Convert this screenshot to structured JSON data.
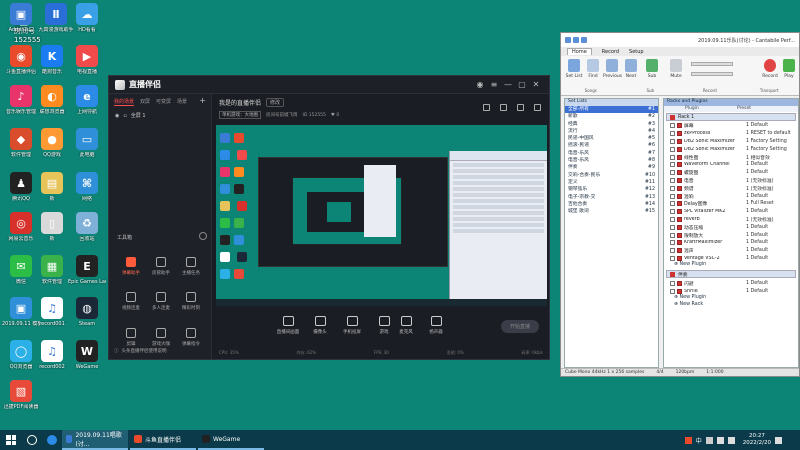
{
  "watermark": {
    "line1": "S鱼",
    "line2": "房间号",
    "line3": "152555"
  },
  "desktop_icons": [
    {
      "id": "admin",
      "label": "Adminis...",
      "color": "#3a7bd5",
      "glyph": "▣"
    },
    {
      "id": "jiuqi",
      "label": "九霄漫游戏助手",
      "color": "#2a6fd8",
      "glyph": "Ⅱ"
    },
    {
      "id": "hdstream",
      "label": "HD看看",
      "color": "#3aa0e6",
      "glyph": "☁"
    },
    {
      "id": "douyu",
      "label": "斗鱼直播伴侣",
      "color": "#e84a2b",
      "glyph": "◉"
    },
    {
      "id": "kugou",
      "label": "酷狗音乐",
      "color": "#1a7cf0",
      "glyph": "K"
    },
    {
      "id": "tv",
      "label": "电视直播",
      "color": "#f04a4a",
      "glyph": "▶"
    },
    {
      "id": "music",
      "label": "音乐娱乐管理",
      "color": "#e8336b",
      "glyph": "♪"
    },
    {
      "id": "lianxiang",
      "label": "联想浏览器",
      "color": "#ff8a1f",
      "glyph": "◐"
    },
    {
      "id": "ie",
      "label": "上网导航",
      "color": "#2b8be6",
      "glyph": "e"
    },
    {
      "id": "store",
      "label": "软件管理",
      "color": "#d94c2c",
      "glyph": "◆"
    },
    {
      "id": "qqgame",
      "label": "QQ游戏",
      "color": "#ff9933",
      "glyph": "●"
    },
    {
      "id": "computer",
      "label": "此电脑",
      "color": "#2f8fd8",
      "glyph": "▭"
    },
    {
      "id": "qq",
      "label": "腾讯QQ",
      "color": "#222222",
      "glyph": "♟"
    },
    {
      "id": "folder1",
      "label": "新",
      "color": "#e6c45a",
      "glyph": "▤"
    },
    {
      "id": "network",
      "label": "网络",
      "color": "#2f8fd8",
      "glyph": "⌘"
    },
    {
      "id": "netease",
      "label": "网易云音乐",
      "color": "#d8312b",
      "glyph": "◎"
    },
    {
      "id": "file1",
      "label": "新",
      "color": "#d9d9d9",
      "glyph": "▯"
    },
    {
      "id": "recycle",
      "label": "回收站",
      "color": "#7fb0d8",
      "glyph": "♻"
    },
    {
      "id": "wechat",
      "label": "微信",
      "color": "#2bbd45",
      "glyph": "✉"
    },
    {
      "id": "store2",
      "label": "软件管理",
      "color": "#3ab24a",
      "glyph": "▦"
    },
    {
      "id": "epic",
      "label": "Epic Games Launcher",
      "color": "#222222",
      "glyph": "E"
    },
    {
      "id": "sheet",
      "label": "2019.09.11 模板",
      "color": "#2f8fd8",
      "glyph": "▣"
    },
    {
      "id": "mp3a",
      "label": "record001",
      "color": "#ffffff",
      "glyph": "♫"
    },
    {
      "id": "steam",
      "label": "Steam",
      "color": "#1b2838",
      "glyph": "◍"
    },
    {
      "id": "qqbrowser",
      "label": "QQ浏览器",
      "color": "#2bb0e8",
      "glyph": "◯"
    },
    {
      "id": "mp3b",
      "label": "record002",
      "color": "#ffffff",
      "glyph": "♫"
    },
    {
      "id": "wegame",
      "label": "WeGame",
      "color": "#222222",
      "glyph": "W"
    },
    {
      "id": "pdf",
      "label": "迅捷PDF阅读器",
      "color": "#e84a3a",
      "glyph": "▧"
    }
  ],
  "app": {
    "name": "直播伴侣",
    "tabs": [
      "我的场景",
      "双屏",
      "可变屏",
      "场景"
    ],
    "scene": "全屏 1",
    "tools_label": "工具箱",
    "tools": [
      "弹幕助手",
      "房管助手",
      "主播任务",
      "视频连麦",
      "多人连麦",
      "精彩时刻",
      "剪辑",
      "游戏大咖",
      "弹幕指令"
    ],
    "tip": "头条直播伴侣使用说明",
    "room_title": "我是的直播伴侣",
    "edit_label": "修改",
    "room_category": "单机游戏：大地图",
    "room_link": "房间号前缀飞周",
    "room_id": "152555",
    "room_followers": "0",
    "controls": [
      "直播间画面",
      "摄像头",
      "手机投屏",
      "游戏",
      "麦克风",
      "扬声器"
    ],
    "start_label": "开始直播",
    "status": [
      "CPU: 35%",
      "内存: 62%",
      "FPS: 30",
      "丢帧: 0%",
      "码率: 0kb/s"
    ]
  },
  "cantabile": {
    "title": "2019.09.11乐队(讨论) - Cantabile Perf...",
    "menus": [
      "Home",
      "Record",
      "Setup"
    ],
    "ribbon": [
      "Set List",
      "Find",
      "Previous",
      "Next",
      "Sub",
      "Mute",
      "Record",
      "Play"
    ],
    "ribbon_groups": [
      "Songs",
      "Sub",
      "Record",
      "Transport"
    ],
    "setlist_header": "Set Lists",
    "setlist": [
      {
        "name": "全部-所有",
        "key": "#1"
      },
      {
        "name": "新歌",
        "key": "#2"
      },
      {
        "name": "经典",
        "key": "#3"
      },
      {
        "name": "流行",
        "key": "#4"
      },
      {
        "name": "民谣-中国风",
        "key": "#5"
      },
      {
        "name": "摇滚-民谣",
        "key": "#6"
      },
      {
        "name": "电音-乐风",
        "key": "#7"
      },
      {
        "name": "电音-乐风",
        "key": "#8"
      },
      {
        "name": "伴奏",
        "key": "#9"
      },
      {
        "name": "交响-合奏-民乐",
        "key": "#10"
      },
      {
        "name": "定义",
        "key": "#11"
      },
      {
        "name": "钢琴弦乐",
        "key": "#12"
      },
      {
        "name": "电子-宗教-交",
        "key": "#13"
      },
      {
        "name": "吉他合奏",
        "key": "#14"
      },
      {
        "name": "城堡 歌词",
        "key": "#15"
      }
    ],
    "racks_header": "Racks and Plugins",
    "columns": [
      "Plugin",
      "Preset"
    ],
    "rack1": "Rack 1",
    "plugins": [
      {
        "name": "屏幕",
        "preset": "1 Default"
      },
      {
        "name": "zkPProcess",
        "preset": "1 RESET to default"
      },
      {
        "name": "DB2 Sonic Maximizer",
        "preset": "1 Factory Setting"
      },
      {
        "name": "DB2 Sonic Maximizer",
        "preset": "1 Factory Setting"
      },
      {
        "name": "线性图",
        "preset": "1 相似音效"
      },
      {
        "name": "Waveform Channel",
        "preset": "1 Default"
      },
      {
        "name": "螺旋图",
        "preset": "1 Default"
      },
      {
        "name": "电音",
        "preset": "1 (无效标准)"
      },
      {
        "name": "频谱",
        "preset": "1 (无效标准)"
      },
      {
        "name": "混响",
        "preset": "1 Default"
      },
      {
        "name": "Delay图像",
        "preset": "1 Full Reset"
      },
      {
        "name": "SPL Vitalizer MK2",
        "preset": "1 Default"
      },
      {
        "name": "reverb",
        "preset": "1 (无效标准)"
      },
      {
        "name": "动态压缩",
        "preset": "1 Default"
      },
      {
        "name": "限制放大",
        "preset": "1 Default"
      },
      {
        "name": "KraftrMaximizer",
        "preset": "1 Default"
      },
      {
        "name": "混声",
        "preset": "1 Default"
      },
      {
        "name": "Ventage VSC-2",
        "preset": "1 Default"
      }
    ],
    "new_plugin": "New Plugin",
    "rack2": "伴奏",
    "rack2_plugins": [
      {
        "name": "闪避",
        "preset": "1 Default"
      },
      {
        "name": "Shrile",
        "preset": "1 Default"
      }
    ],
    "new_rack": "New Rack",
    "status": [
      "Cube Mono 44kHz 1 x 256 samples",
      "4/4",
      "120bpm",
      "1:1:000"
    ]
  },
  "taskbar": {
    "tasks": [
      {
        "label": "2019.09.11唱歌(讨...",
        "active": true
      },
      {
        "label": "斗鱼直播伴侣",
        "active": false
      },
      {
        "label": "WeGame",
        "active": false
      }
    ],
    "time": "20:27",
    "date": "2022/2/20",
    "lang": "中"
  }
}
